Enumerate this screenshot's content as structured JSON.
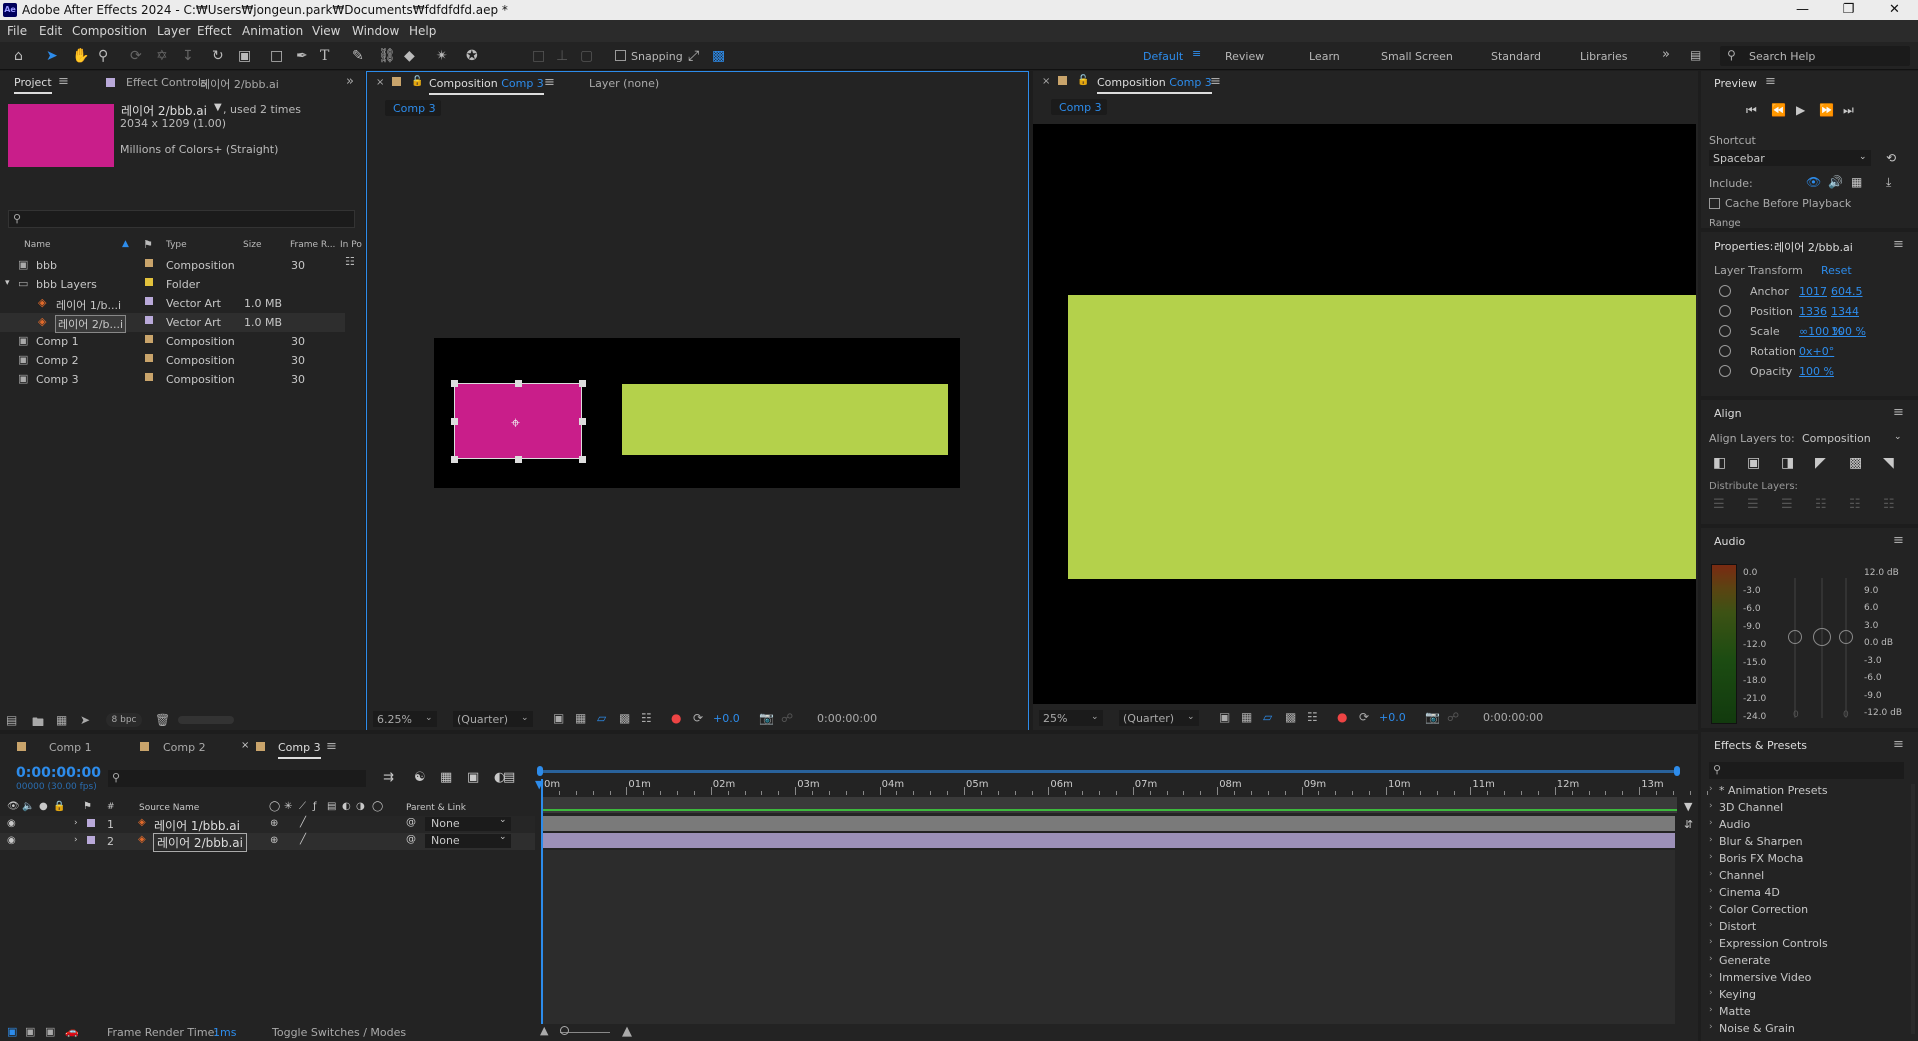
{
  "titlebar": {
    "title": "Adobe After Effects 2024 - C:₩Users₩jongeun.park₩Documents₩fdfdfdfd.aep *",
    "logo": "Ae"
  },
  "menu": [
    "File",
    "Edit",
    "Composition",
    "Layer",
    "Effect",
    "Animation",
    "View",
    "Window",
    "Help"
  ],
  "toolbar": {
    "snapping_label": "Snapping",
    "workspaces": [
      "Default",
      "Review",
      "Learn",
      "Small Screen",
      "Standard",
      "Libraries"
    ],
    "active_workspace": "Default",
    "search_help": "Search Help"
  },
  "project": {
    "tab_project": "Project",
    "tab_effect_controls": "Effect Controls",
    "tab_effect_controls_layer": "레이어 2/bbb.ai",
    "item_name": "레이어 2/bbb.ai",
    "item_used": ", used 2 times",
    "item_dims": "2034 x 1209 (1.00)",
    "item_colors": "Millions of Colors+ (Straight)",
    "search_placeholder": "",
    "columns": [
      "Name",
      "Type",
      "Size",
      "Frame R...",
      "In Po"
    ],
    "items": [
      {
        "name": "bbb",
        "type": "Composition",
        "size": "",
        "fr": "30",
        "color": "#c9a46b"
      },
      {
        "name": "bbb Layers",
        "type": "Folder",
        "size": "",
        "fr": "",
        "color": "#e3c23c"
      },
      {
        "name": "레이어 1/b...i",
        "type": "Vector Art",
        "size": "1.0 MB",
        "fr": "",
        "color": "#b9a9d9"
      },
      {
        "name": "레이어 2/b...i",
        "type": "Vector Art",
        "size": "1.0 MB",
        "fr": "",
        "color": "#b9a9d9"
      },
      {
        "name": "Comp 1",
        "type": "Composition",
        "size": "",
        "fr": "30",
        "color": "#c9a46b"
      },
      {
        "name": "Comp 2",
        "type": "Composition",
        "size": "",
        "fr": "30",
        "color": "#c9a46b"
      },
      {
        "name": "Comp 3",
        "type": "Composition",
        "size": "",
        "fr": "30",
        "color": "#c9a46b"
      }
    ],
    "bpc": "8 bpc"
  },
  "comp_left": {
    "tab_label": "Composition",
    "tab_comp": "Comp 3",
    "layer_tab": "Layer (none)",
    "breadcrumb": "Comp 3",
    "zoom": "6.25%",
    "quality": "(Quarter)",
    "exposure": "+0.0",
    "timecode": "0:00:00:00"
  },
  "comp_right": {
    "tab_label": "Composition",
    "tab_comp": "Comp 3",
    "breadcrumb": "Comp 3",
    "zoom": "25%",
    "quality": "(Quarter)",
    "exposure": "+0.0",
    "timecode": "0:00:00:00"
  },
  "preview": {
    "title": "Preview",
    "shortcut_label": "Shortcut",
    "shortcut_value": "Spacebar",
    "include_label": "Include:",
    "cache_label": "Cache Before Playback",
    "range_label": "Range"
  },
  "properties": {
    "title": "Properties:",
    "layer": "레이어 2/bbb.ai",
    "section": "Layer Transform",
    "reset": "Reset",
    "rows": [
      {
        "name": "Anchor",
        "v1": "1017",
        "v2": "604.5"
      },
      {
        "name": "Position",
        "v1": "1336",
        "v2": "1344"
      },
      {
        "name": "Scale",
        "v1": "∞100 %",
        "v2": "100 %"
      },
      {
        "name": "Rotation",
        "v1": "0x+0°",
        "v2": ""
      },
      {
        "name": "Opacity",
        "v1": "100 %",
        "v2": ""
      }
    ]
  },
  "align": {
    "title": "Align",
    "align_to_label": "Align Layers to:",
    "align_to_value": "Composition",
    "distribute_label": "Distribute Layers:"
  },
  "audio": {
    "title": "Audio",
    "left_scale": [
      "0.0",
      "-3.0",
      "-6.0",
      "-9.0",
      "-12.0",
      "-15.0",
      "-18.0",
      "-21.0",
      "-24.0"
    ],
    "right_scale": [
      "12.0 dB",
      "9.0",
      "6.0",
      "3.0",
      "0.0 dB",
      "-3.0",
      "-6.0",
      "-9.0",
      "-12.0 dB"
    ],
    "slider_zero_a": "0",
    "slider_zero_b": "0"
  },
  "effects": {
    "title": "Effects & Presets",
    "search_placeholder": "",
    "items": [
      "* Animation Presets",
      "3D Channel",
      "Audio",
      "Blur & Sharpen",
      "Boris FX Mocha",
      "Channel",
      "Cinema 4D",
      "Color Correction",
      "Distort",
      "Expression Controls",
      "Generate",
      "Immersive Video",
      "Keying",
      "Matte",
      "Noise & Grain"
    ]
  },
  "timeline": {
    "tabs": [
      "Comp 1",
      "Comp 2",
      "Comp 3"
    ],
    "active_tab": "Comp 3",
    "timecode": "0:00:00:00",
    "frame_info": "00000 (30.00 fps)",
    "col_source": "Source Name",
    "col_parent": "Parent & Link",
    "ruler": [
      "0m",
      "01m",
      "02m",
      "03m",
      "04m",
      "05m",
      "06m",
      "07m",
      "08m",
      "09m",
      "10m",
      "11m",
      "12m",
      "13m"
    ],
    "layers": [
      {
        "num": "1",
        "name": "레이어 1/bbb.ai",
        "parent": "None"
      },
      {
        "num": "2",
        "name": "레이어 2/bbb.ai",
        "parent": "None"
      }
    ],
    "render_time_label": "Frame Render Time:",
    "render_time_value": "1ms",
    "toggle_label": "Toggle Switches / Modes"
  },
  "colors": {
    "magenta": "#c91e8a",
    "lime": "#b4d14b",
    "accent": "#2d8ceb"
  }
}
